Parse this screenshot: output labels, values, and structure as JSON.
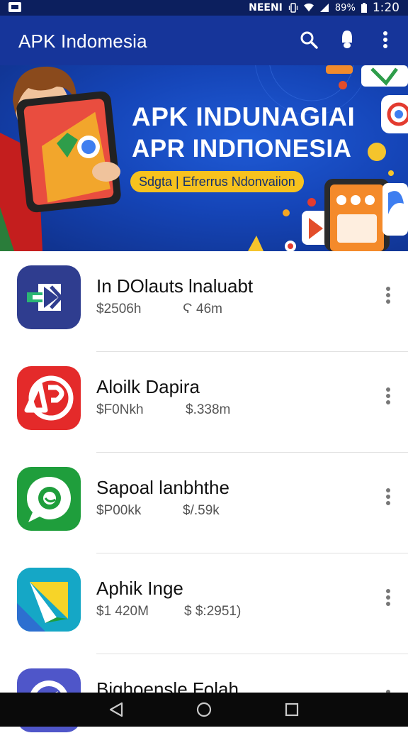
{
  "status_bar": {
    "carrier": "NEENI",
    "battery": "89%",
    "time": "1:20",
    "icons": [
      "image-icon",
      "vibrate-icon",
      "wifi-icon",
      "signal-icon",
      "battery-icon"
    ]
  },
  "app_bar": {
    "title": "APK Indomesia",
    "actions": [
      "search-icon",
      "notification-icon",
      "more-vert-icon"
    ]
  },
  "banner": {
    "line1": "APK INDUNAGIAI",
    "line2": "APR INDΠONESIA",
    "pill": "Sdgta | Efrerrus Ndonvaiion"
  },
  "apps": [
    {
      "name": "In DOlauts lnaluabt",
      "size": "$2506h",
      "downloads": "Ϛ 46m",
      "icon": "dx-icon",
      "color": "#2f3d8f"
    },
    {
      "name": "Aloilk Dapira",
      "size": "$F0Nkh",
      "downloads": "$.338m",
      "icon": "ap-icon",
      "color": "#e42a2a"
    },
    {
      "name": "Sapoal lanbhthe",
      "size": "$P00kk",
      "downloads": "$/.59k",
      "icon": "chat-icon",
      "color": "#1f9e3c"
    },
    {
      "name": "Aphik Inge",
      "size": "$1 420M",
      "downloads": "$ $:2951)",
      "icon": "folded-ribbon-icon",
      "color": "#1ab0c8"
    },
    {
      "name": "Biqhoensle Folah",
      "size": "",
      "downloads": "",
      "icon": "compass-icon",
      "color": "#4f56c9"
    }
  ],
  "nav": [
    "back-icon",
    "home-icon",
    "recents-icon"
  ]
}
